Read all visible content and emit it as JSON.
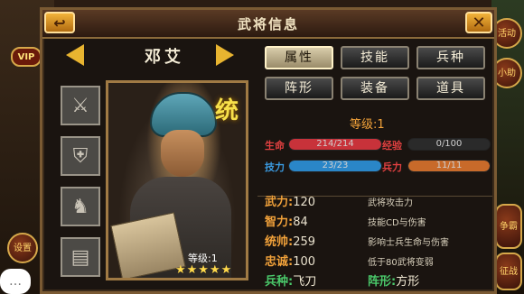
{
  "window": {
    "title": "武将信息",
    "back_icon": "↩",
    "close_icon": "✕"
  },
  "hero": {
    "name": "邓艾",
    "level_label": "等级:1",
    "stars": "★★★★★",
    "badge": "统"
  },
  "equip_slots": [
    "polearm-icon",
    "armor-icon",
    "horse-icon",
    "book-icon"
  ],
  "tabs": [
    "属性",
    "技能",
    "兵种",
    "阵形",
    "装备",
    "道具"
  ],
  "level": {
    "label": "等级:",
    "value": "1"
  },
  "bars": {
    "hp": {
      "label": "生命",
      "text": "214/214",
      "fill": 1.0,
      "color": "#c8323a"
    },
    "exp": {
      "label": "经验",
      "text": "0/100",
      "fill": 0.0,
      "color": "#7a7a7a"
    },
    "skill": {
      "label": "技力",
      "text": "23/23",
      "fill": 1.0,
      "color": "#2a86c8"
    },
    "troops": {
      "label": "兵力",
      "text": "11/11",
      "fill": 1.0,
      "color": "#c86a2a"
    }
  },
  "attributes": [
    {
      "name": "武力:",
      "value": "120",
      "desc": "武将攻击力"
    },
    {
      "name": "智力:",
      "value": "84",
      "desc": "技能CD与伤害"
    },
    {
      "name": "统帅:",
      "value": "259",
      "desc": "影响士兵生命与伤害"
    },
    {
      "name": "忠诚:",
      "value": "100",
      "desc": "低于80武将变弱"
    }
  ],
  "troop_type": {
    "label": "兵种:",
    "value": "飞刀"
  },
  "formation": {
    "label": "阵形:",
    "value": "方形"
  },
  "side": {
    "vip": "VIP",
    "settings": "设置",
    "chat": "…",
    "right_top": "活动",
    "right_top2": "小助",
    "right_mid": "争霸",
    "right_bot": "征战"
  }
}
